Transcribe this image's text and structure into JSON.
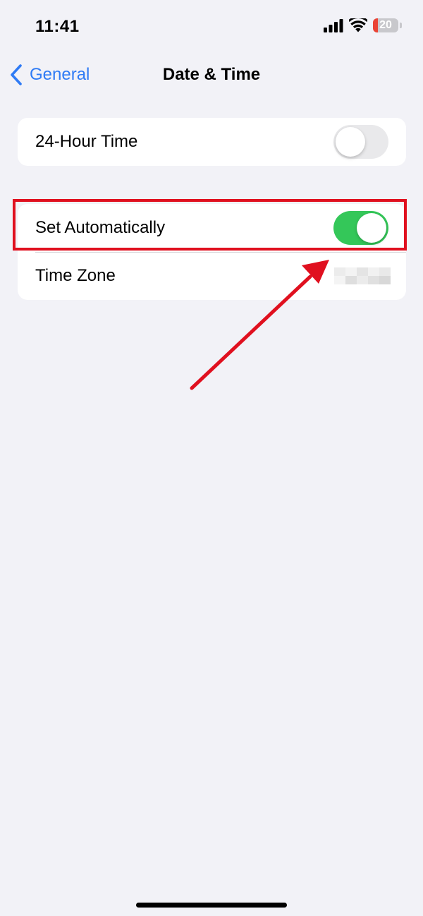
{
  "status_bar": {
    "time": "11:41",
    "battery_level": "20",
    "battery_fraction": 0.2,
    "icons": [
      "cell-signal-icon",
      "wifi-icon",
      "battery-icon"
    ]
  },
  "nav": {
    "back_label": "General",
    "title": "Date & Time"
  },
  "settings": {
    "hour24": {
      "label": "24-Hour Time",
      "toggle_on": false
    },
    "set_automatically": {
      "label": "Set Automatically",
      "toggle_on": true
    },
    "time_zone": {
      "label": "Time Zone",
      "value_obscured": true
    }
  },
  "colors": {
    "accent": "#2f7bf5",
    "toggle_on": "#34c759",
    "toggle_off": "#e9e9eb",
    "annotation": "#e0101f",
    "background": "#f2f2f7"
  }
}
